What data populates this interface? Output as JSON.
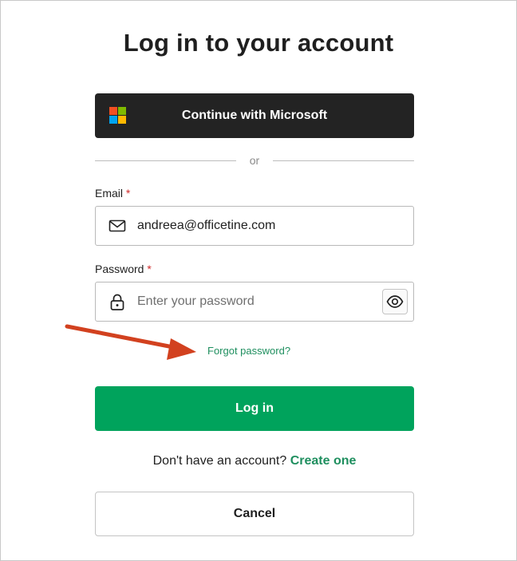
{
  "page": {
    "title": "Log in to your account"
  },
  "microsoft_button": {
    "label": "Continue with Microsoft",
    "icon": "microsoft-logo-icon",
    "logo_colors": [
      "#f25022",
      "#7fba00",
      "#00a4ef",
      "#ffb900"
    ]
  },
  "divider": {
    "text": "or"
  },
  "email": {
    "label": "Email",
    "required_mark": "*",
    "value": "andreea@officetine.com",
    "icon": "envelope-icon"
  },
  "password": {
    "label": "Password",
    "required_mark": "*",
    "placeholder": "Enter your password",
    "icon": "lock-icon",
    "toggle_icon": "eye-icon"
  },
  "forgot_password": {
    "text": "Forgot password?"
  },
  "login_button": {
    "label": "Log in"
  },
  "signup": {
    "prompt": "Don't have an account?",
    "link": "Create one"
  },
  "cancel_button": {
    "label": "Cancel"
  },
  "colors": {
    "accent_green": "#00a35c",
    "link_green": "#1f8f5f",
    "dark_button": "#232323",
    "annotation_arrow": "#d2411f",
    "required": "#d12c2c"
  }
}
